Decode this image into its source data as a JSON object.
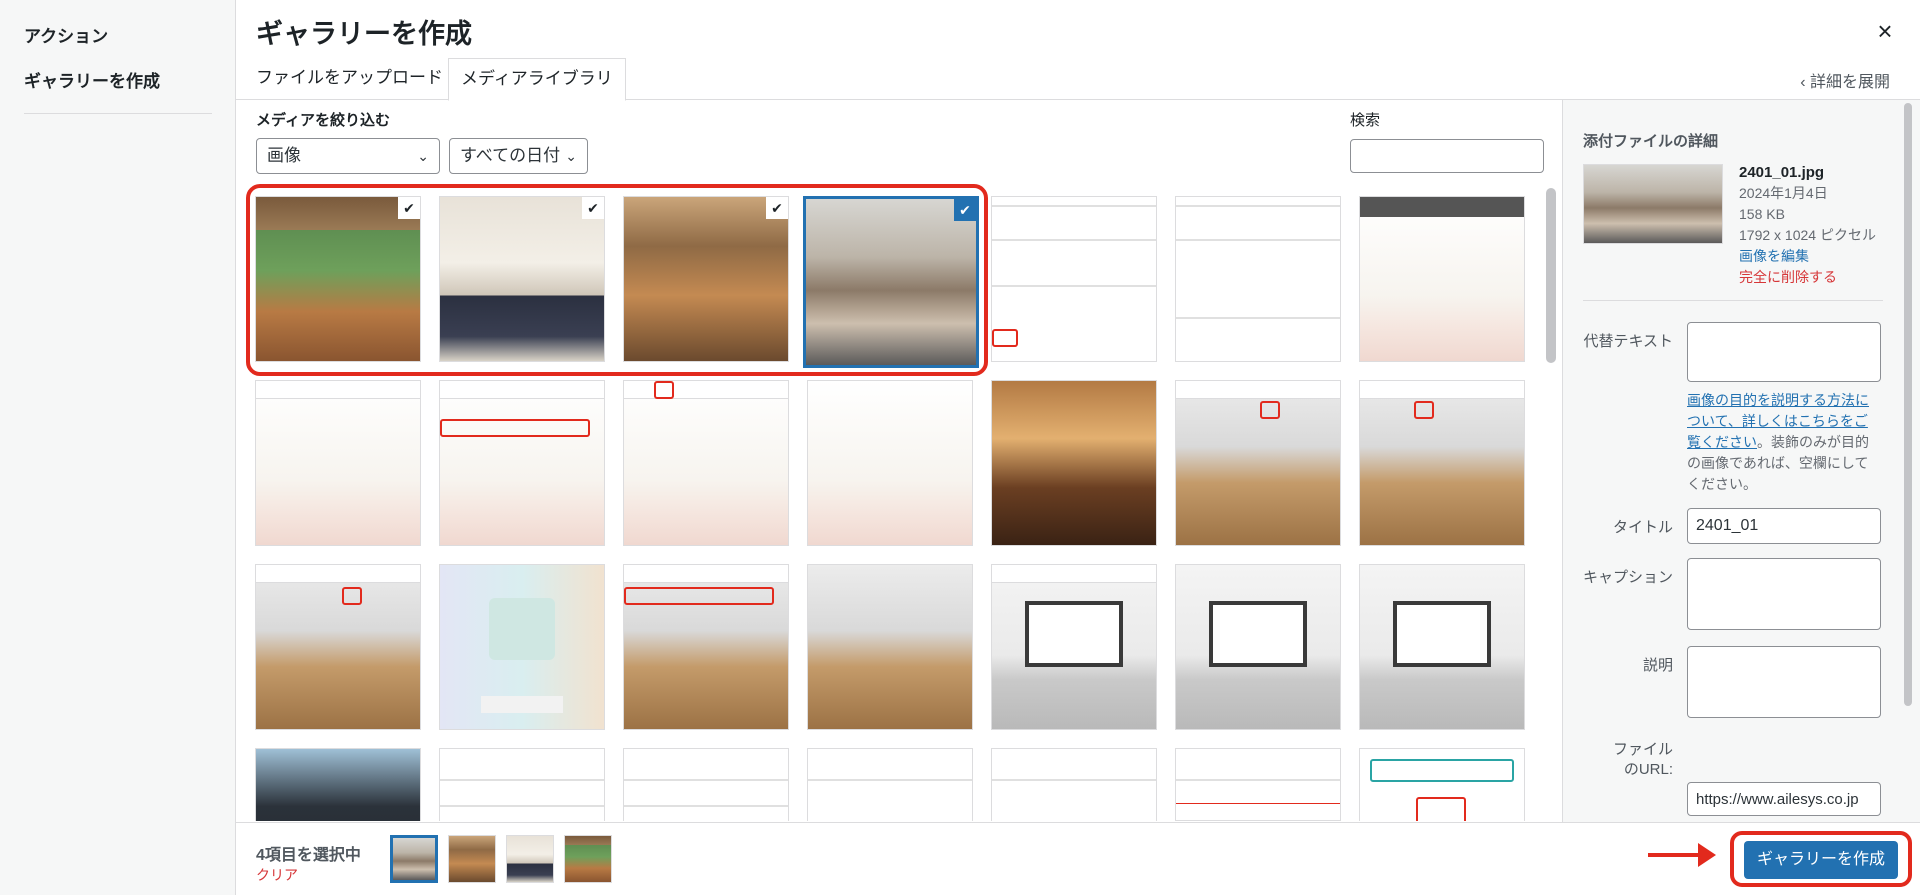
{
  "sidebar": {
    "section_title": "アクション",
    "items": [
      {
        "label": "ギャラリーを作成"
      }
    ]
  },
  "header": {
    "title": "ギャラリーを作成",
    "close_icon": "×",
    "tabs": [
      {
        "label": "ファイルをアップロード"
      },
      {
        "label": "メディアライブラリ"
      }
    ],
    "expand_label": "‹ 詳細を展開"
  },
  "filters": {
    "label": "メディアを絞り込む",
    "type_value": "画像",
    "date_value": "すべての日付",
    "search_label": "検索",
    "search_value": ""
  },
  "grid": {
    "selected_count": 4,
    "checkmark": "✔",
    "rows": 4,
    "cols": 7
  },
  "details": {
    "heading": "添付ファイルの詳細",
    "filename": "2401_01.jpg",
    "date": "2024年1月4日",
    "size": "158 KB",
    "dimensions": "1792 x 1024 ピクセル",
    "edit_label": "画像を編集",
    "delete_label": "完全に削除する",
    "alt_label": "代替テキスト",
    "alt_value": "",
    "help_link": "画像の目的を説明する方法について、詳しくはこちらをご覧ください",
    "help_rest": "。装飾のみが目的の画像であれば、空欄にしてください。",
    "title_label": "タイトル",
    "title_value": "2401_01",
    "caption_label": "キャプション",
    "caption_value": "",
    "description_label": "説明",
    "description_value": "",
    "url_label": "ファイルのURL:",
    "url_value": "https://www.ailesys.co.jp"
  },
  "footer": {
    "selected_label": "4項目を選択中",
    "clear_label": "クリア",
    "create_label": "ギャラリーを作成"
  },
  "colors": {
    "accent": "#2271b1",
    "annotation": "#e22a1d",
    "danger": "#d63638"
  }
}
